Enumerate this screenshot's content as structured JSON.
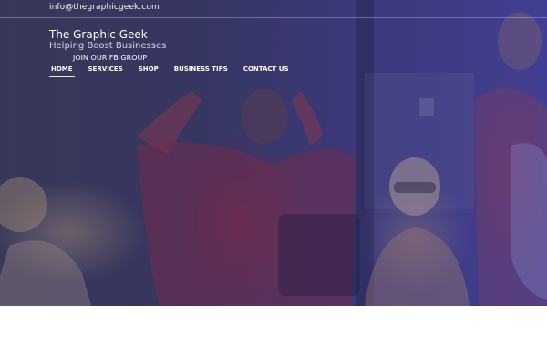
{
  "topbar": {
    "email": "info@thegraphicgeek.com"
  },
  "branding": {
    "title": "The Graphic Geek",
    "tagline": "Helping Boost Businesses",
    "fb_link": "JOIN OUR FB GROUP"
  },
  "nav": {
    "items": [
      {
        "label": "HOME",
        "active": true
      },
      {
        "label": "SERVICES",
        "active": false
      },
      {
        "label": "SHOP",
        "active": false
      },
      {
        "label": "BUSINESS TIPS",
        "active": false
      },
      {
        "label": "CONTACT US",
        "active": false
      }
    ]
  },
  "hero": {
    "overlay_color": "#3f3f8a",
    "image_subject": "people celebrating in an office"
  }
}
